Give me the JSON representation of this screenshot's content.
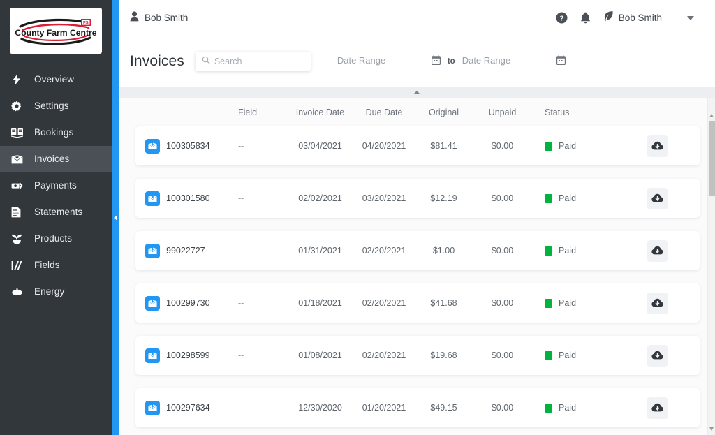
{
  "brand": {
    "logo_text": "County Farm Centre",
    "accent_blue": "#2196f3",
    "sidebar_bg": "#32373c",
    "status_green": "#00b33c"
  },
  "sidebar": {
    "items": [
      {
        "label": "Overview",
        "icon": "bolt-icon",
        "active": false
      },
      {
        "label": "Settings",
        "icon": "gear-icon",
        "active": false
      },
      {
        "label": "Bookings",
        "icon": "book-icon",
        "active": false
      },
      {
        "label": "Invoices",
        "icon": "invoice-icon",
        "active": true
      },
      {
        "label": "Payments",
        "icon": "money-icon",
        "active": false
      },
      {
        "label": "Statements",
        "icon": "statement-icon",
        "active": false
      },
      {
        "label": "Products",
        "icon": "sprout-icon",
        "active": false
      },
      {
        "label": "Fields",
        "icon": "field-icon",
        "active": false
      },
      {
        "label": "Energy",
        "icon": "energy-icon",
        "active": false
      }
    ],
    "collapse_handle": "collapse-sidebar-handle"
  },
  "topbar": {
    "account_name": "Bob Smith",
    "help_icon": "help-circle-icon",
    "notifications_icon": "bell-icon",
    "leaf_icon": "leaf-icon",
    "user_name": "Bob Smith",
    "caret_icon": "chevron-down-icon"
  },
  "pagehead": {
    "title": "Invoices",
    "search": {
      "placeholder": "Search",
      "value": "",
      "icon": "search-icon"
    },
    "date_from": {
      "placeholder": "Date Range",
      "value": "",
      "icon": "calendar-icon"
    },
    "separator_label": "to",
    "date_to": {
      "placeholder": "Date Range",
      "value": "",
      "icon": "calendar-icon"
    },
    "collapse_chevron": "chevron-up-icon"
  },
  "table": {
    "columns": [
      "",
      "Field",
      "Invoice Date",
      "Due Date",
      "Original",
      "Unpaid",
      "Status",
      ""
    ],
    "download_icon": "cloud-download-icon",
    "row_icon": "invoice-document-icon",
    "rows": [
      {
        "invoice_number": "100305834",
        "field": "--",
        "invoice_date": "03/04/2021",
        "due_date": "04/20/2021",
        "original": "$81.41",
        "unpaid": "$0.00",
        "status": "Paid"
      },
      {
        "invoice_number": "100301580",
        "field": "--",
        "invoice_date": "02/02/2021",
        "due_date": "03/20/2021",
        "original": "$12.19",
        "unpaid": "$0.00",
        "status": "Paid"
      },
      {
        "invoice_number": "99022727",
        "field": "--",
        "invoice_date": "01/31/2021",
        "due_date": "02/20/2021",
        "original": "$1.00",
        "unpaid": "$0.00",
        "status": "Paid"
      },
      {
        "invoice_number": "100299730",
        "field": "--",
        "invoice_date": "01/18/2021",
        "due_date": "02/20/2021",
        "original": "$41.68",
        "unpaid": "$0.00",
        "status": "Paid"
      },
      {
        "invoice_number": "100298599",
        "field": "--",
        "invoice_date": "01/08/2021",
        "due_date": "02/20/2021",
        "original": "$19.68",
        "unpaid": "$0.00",
        "status": "Paid"
      },
      {
        "invoice_number": "100297634",
        "field": "--",
        "invoice_date": "12/30/2020",
        "due_date": "01/20/2021",
        "original": "$49.15",
        "unpaid": "$0.00",
        "status": "Paid"
      }
    ]
  },
  "scrollbar": {
    "up_icon": "scroll-up-arrow",
    "down_icon": "scroll-down-arrow"
  }
}
